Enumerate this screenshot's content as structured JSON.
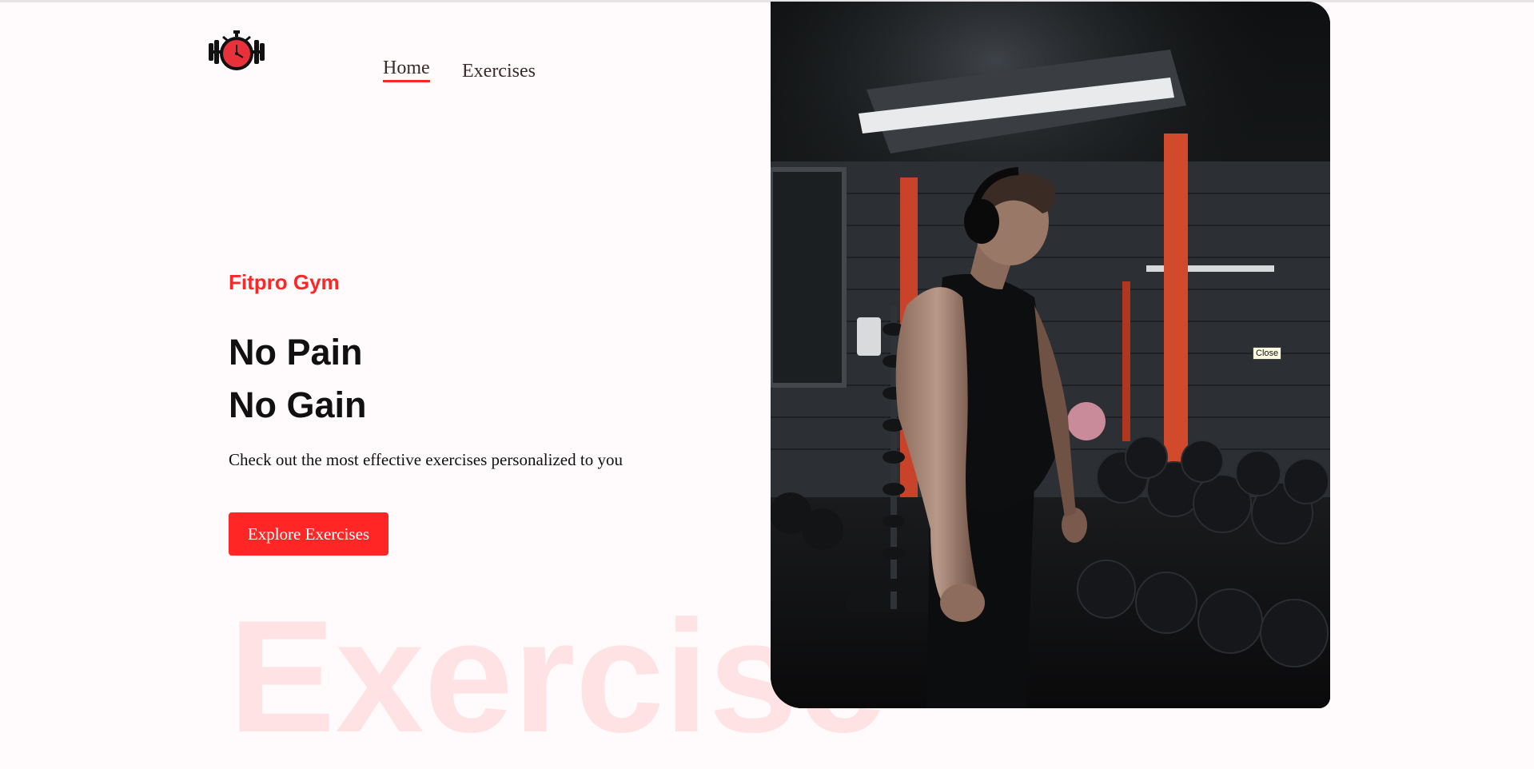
{
  "nav": {
    "home_label": "Home",
    "exercises_label": "Exercises"
  },
  "hero": {
    "brand": "Fitpro Gym",
    "headline_line1": "No Pain",
    "headline_line2": "No Gain",
    "subtext": "Check out the most effective exercises personalized to you",
    "cta_label": "Explore Exercises",
    "watermark": "Exercise"
  },
  "tooltip": {
    "text": "Close"
  },
  "icons": {
    "logo": "stopwatch-dumbbell-logo-icon"
  },
  "colors": {
    "accent": "#ff2625",
    "background": "#fffafb",
    "text": "#111111"
  }
}
